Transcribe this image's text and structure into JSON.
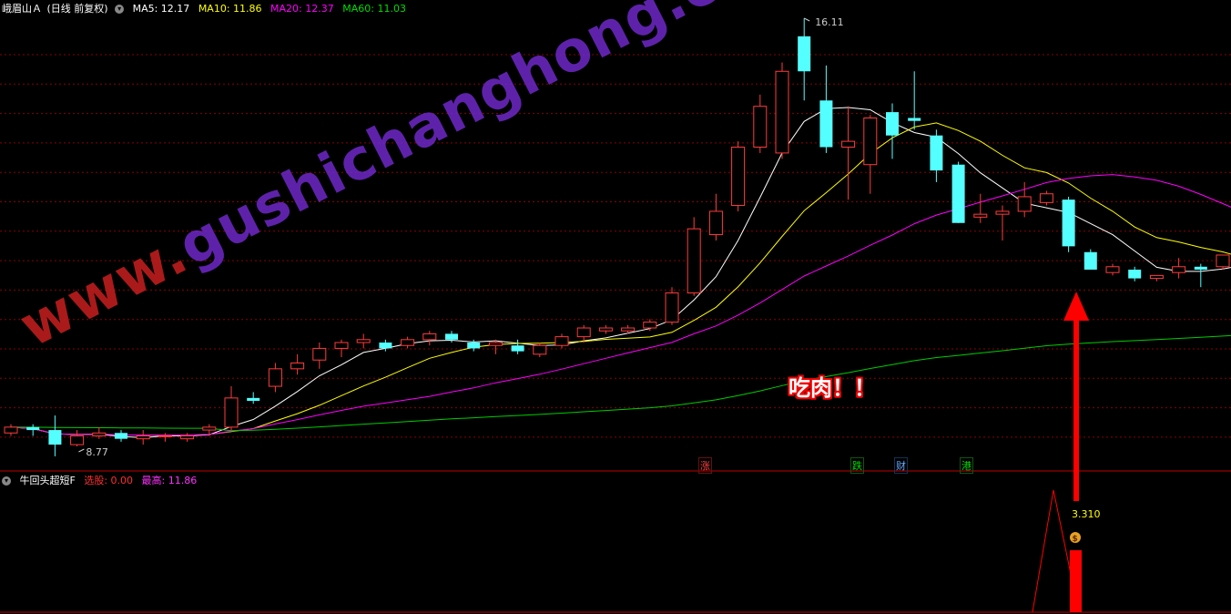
{
  "header": {
    "stock": "峨眉山Ａ",
    "mode": "(日线 前复权)",
    "ma5": "MA5: 12.17",
    "ma10": "MA10: 11.86",
    "ma20": "MA20: 12.37",
    "ma60": "MA60: 11.03"
  },
  "sub_header": {
    "name": "牛回头超短F",
    "buy": "选股: 0.00",
    "high": "最高: 11.86"
  },
  "tags": {
    "zhang": "涨",
    "die": "跌",
    "cai": "财",
    "gang": "港"
  },
  "callout": "吃肉！！",
  "watermark": {
    "part1": "www.",
    "part2": "gushichanghong.com"
  },
  "colors": {
    "up": "#ff3b3b",
    "down": "#54ffff",
    "ma5": "#ffffff",
    "ma10": "#ffff00",
    "ma20": "#ff00ff",
    "ma60": "#00cc00",
    "grid": "#8b0000",
    "signal": "#ff0000"
  },
  "chart_data": {
    "type": "candlestick",
    "y_axis_reference": {
      "high_label": "16.11",
      "low_label": "8.77"
    },
    "candles": [
      [
        9.0,
        9.15,
        8.95,
        9.1
      ],
      [
        9.1,
        9.15,
        8.95,
        9.05
      ],
      [
        9.05,
        9.3,
        8.6,
        8.8
      ],
      [
        8.8,
        9.05,
        8.77,
        8.95
      ],
      [
        8.95,
        9.1,
        8.9,
        9.0
      ],
      [
        9.0,
        9.05,
        8.85,
        8.9
      ],
      [
        8.9,
        9.05,
        8.8,
        8.95
      ],
      [
        8.95,
        9.0,
        8.85,
        8.95
      ],
      [
        8.9,
        9.0,
        8.85,
        8.95
      ],
      [
        9.05,
        9.15,
        8.95,
        9.1
      ],
      [
        9.1,
        9.8,
        9.05,
        9.6
      ],
      [
        9.6,
        9.7,
        9.5,
        9.55
      ],
      [
        9.8,
        10.2,
        9.7,
        10.1
      ],
      [
        10.1,
        10.35,
        10.0,
        10.2
      ],
      [
        10.25,
        10.55,
        10.1,
        10.45
      ],
      [
        10.45,
        10.6,
        10.3,
        10.55
      ],
      [
        10.55,
        10.7,
        10.45,
        10.6
      ],
      [
        10.55,
        10.6,
        10.4,
        10.45
      ],
      [
        10.5,
        10.65,
        10.45,
        10.6
      ],
      [
        10.6,
        10.75,
        10.5,
        10.7
      ],
      [
        10.7,
        10.75,
        10.55,
        10.6
      ],
      [
        10.55,
        10.6,
        10.4,
        10.45
      ],
      [
        10.5,
        10.6,
        10.35,
        10.55
      ],
      [
        10.5,
        10.6,
        10.35,
        10.4
      ],
      [
        10.35,
        10.55,
        10.3,
        10.5
      ],
      [
        10.5,
        10.7,
        10.45,
        10.65
      ],
      [
        10.65,
        10.85,
        10.55,
        10.8
      ],
      [
        10.75,
        10.85,
        10.7,
        10.8
      ],
      [
        10.75,
        10.85,
        10.7,
        10.8
      ],
      [
        10.8,
        10.95,
        10.75,
        10.9
      ],
      [
        10.9,
        11.5,
        10.85,
        11.4
      ],
      [
        11.4,
        12.7,
        11.35,
        12.5
      ],
      [
        12.4,
        13.1,
        12.3,
        12.8
      ],
      [
        12.9,
        14.0,
        12.8,
        13.9
      ],
      [
        13.9,
        14.8,
        13.8,
        14.6
      ],
      [
        13.8,
        15.35,
        13.7,
        15.2
      ],
      [
        15.8,
        16.11,
        14.7,
        15.2
      ],
      [
        14.7,
        15.3,
        13.8,
        13.9
      ],
      [
        13.9,
        14.6,
        13.0,
        14.0
      ],
      [
        13.6,
        14.45,
        13.1,
        14.4
      ],
      [
        14.5,
        14.65,
        13.7,
        14.1
      ],
      [
        14.4,
        15.2,
        14.2,
        14.35
      ],
      [
        14.1,
        14.2,
        13.3,
        13.5
      ],
      [
        13.6,
        13.65,
        12.6,
        12.6
      ],
      [
        12.7,
        13.1,
        12.6,
        12.75
      ],
      [
        12.75,
        12.9,
        12.3,
        12.8
      ],
      [
        12.8,
        13.3,
        12.7,
        13.05
      ],
      [
        12.95,
        13.15,
        12.9,
        13.1
      ],
      [
        13.0,
        13.05,
        12.1,
        12.2
      ],
      [
        12.1,
        12.15,
        11.8,
        11.8
      ],
      [
        11.75,
        11.9,
        11.7,
        11.85
      ],
      [
        11.8,
        11.85,
        11.6,
        11.65
      ],
      [
        11.65,
        11.7,
        11.6,
        11.7
      ],
      [
        11.75,
        12.0,
        11.65,
        11.85
      ],
      [
        11.85,
        11.9,
        11.5,
        11.8
      ],
      [
        11.85,
        12.05,
        11.8,
        12.05
      ],
      [
        11.95,
        12.05,
        11.8,
        12.0
      ],
      [
        12.2,
        12.45,
        11.9,
        12.4
      ],
      [
        12.4,
        12.45,
        12.1,
        12.15
      ],
      [
        12.7,
        13.3,
        12.55,
        13.1
      ]
    ],
    "signal": {
      "value": 3.31,
      "label": "3.310"
    }
  }
}
